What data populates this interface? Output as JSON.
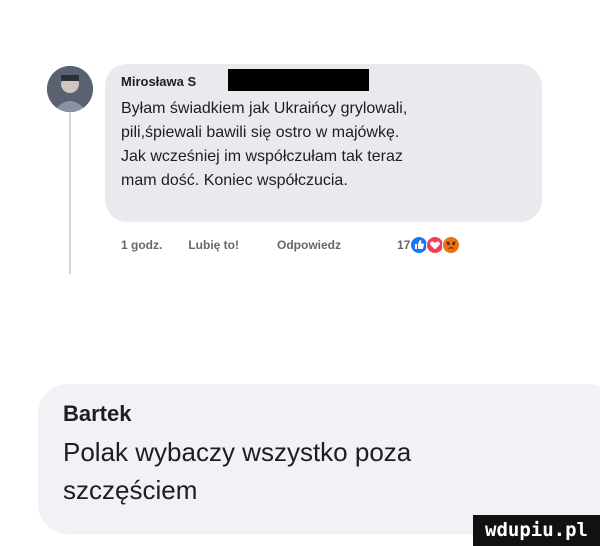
{
  "comment1": {
    "author": "Mirosława S",
    "lines": [
      "Byłam świadkiem jak Ukraińcy grylowali,",
      "pili,śpiewali bawili się ostro w majówkę.",
      "Jak wcześniej im współczułam tak teraz",
      "mam dość. Koniec współczucia."
    ],
    "time": "1 godz.",
    "like_label": "Lubię to!",
    "reply_label": "Odpowiedz",
    "reaction_count": "17",
    "reactions": [
      "like-icon",
      "love-icon",
      "angry-icon"
    ],
    "colors": {
      "like": "#1877f2",
      "love": "#f33e58",
      "angry": "#e9710f"
    }
  },
  "comment2": {
    "author": "Bartek",
    "lines": [
      "Polak wybaczy wszystko poza",
      "szczęściem"
    ]
  },
  "watermark": "wdupiu.pl"
}
